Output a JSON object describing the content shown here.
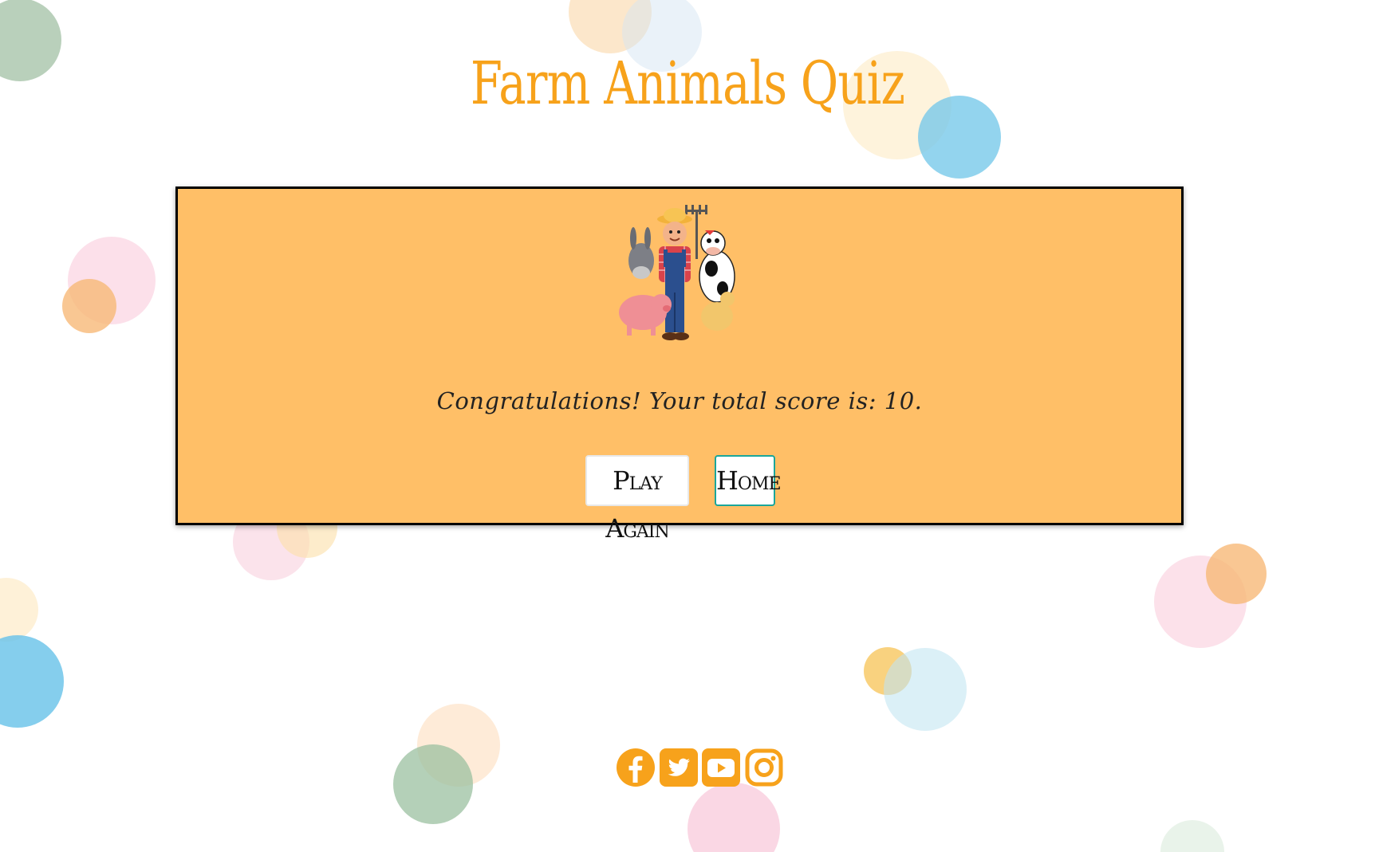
{
  "header": {
    "title": "Farm Animals Quiz"
  },
  "result": {
    "image_icon": "farmer-with-animals-illustration",
    "score_message": "Congratulations! Your total score is: 10.",
    "play_again_label": "Play Again",
    "home_label": "Home"
  },
  "footer": {
    "social_icons": [
      "facebook-icon",
      "twitter-icon",
      "youtube-icon",
      "instagram-icon"
    ]
  },
  "colors": {
    "accent": "#f7a21b",
    "card_background": "#ffbf67",
    "home_border": "#1aa69a"
  }
}
